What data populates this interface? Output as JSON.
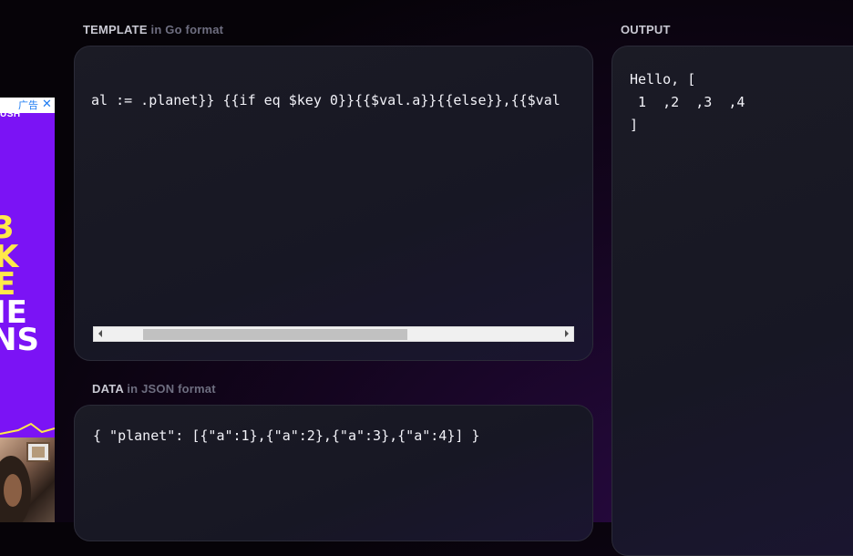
{
  "template_section": {
    "title": "TEMPLATE",
    "subtitle": "in Go format",
    "code": "al := .planet}} {{if eq $key 0}}{{$val.a}}{{else}},{{$val"
  },
  "output_section": {
    "title": "OUTPUT",
    "lines": [
      "Hello, [",
      " 1  ,2  ,3  ,4",
      "]"
    ]
  },
  "data_section": {
    "title": "DATA",
    "subtitle": "in JSON format",
    "code": "{ \"planet\": [{\"a\":1},{\"a\":2},{\"a\":3},{\"a\":4}] }"
  },
  "ad": {
    "badge": "广告",
    "close": "✕",
    "brand": "USH",
    "lines": [
      "3",
      "K",
      "E",
      "IE",
      "NS"
    ],
    "accent_color": "#ffe94a",
    "bg_color": "#7b13f5"
  },
  "scrollbar": {
    "position_fraction": 0.19,
    "visible_fraction": 0.58
  }
}
